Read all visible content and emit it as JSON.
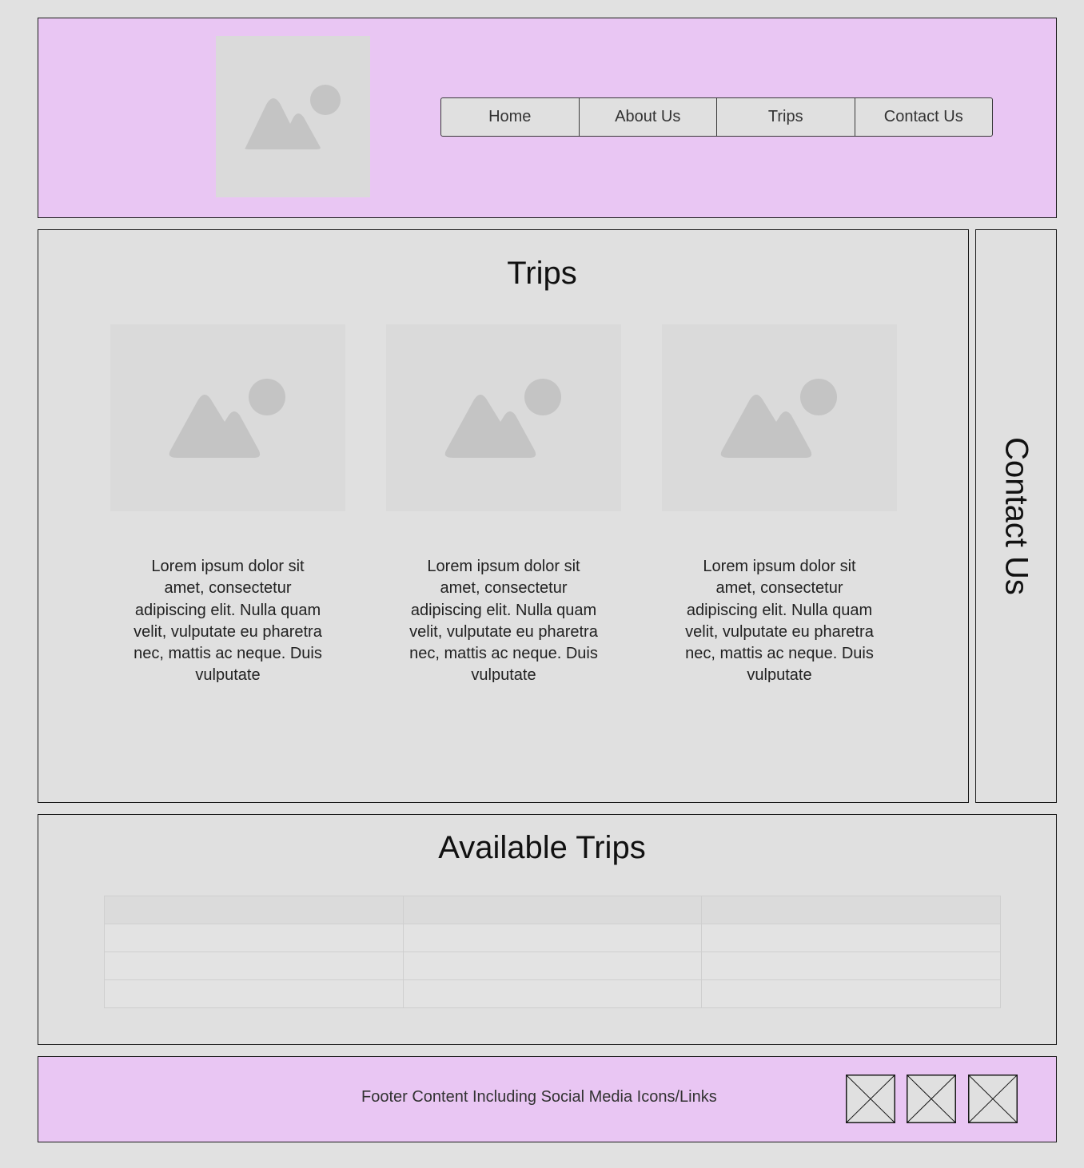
{
  "header": {
    "logo": {
      "icon": "image-placeholder-icon"
    },
    "nav": [
      {
        "label": "Home"
      },
      {
        "label": "About Us"
      },
      {
        "label": "Trips"
      },
      {
        "label": "Contact Us"
      }
    ]
  },
  "main": {
    "title": "Trips",
    "cards": [
      {
        "image_icon": "image-placeholder-icon",
        "text": "Lorem ipsum dolor sit amet, consectetur adipiscing elit. Nulla quam velit, vulputate eu pharetra nec, mattis ac neque. Duis vulputate"
      },
      {
        "image_icon": "image-placeholder-icon",
        "text": "Lorem ipsum dolor sit amet, consectetur adipiscing elit. Nulla quam velit, vulputate eu pharetra nec, mattis ac neque. Duis vulputate"
      },
      {
        "image_icon": "image-placeholder-icon",
        "text": "Lorem ipsum dolor sit amet, consectetur adipiscing elit. Nulla quam velit, vulputate eu pharetra nec, mattis ac neque. Duis vulputate"
      }
    ]
  },
  "sidebar": {
    "label": "Contact Us"
  },
  "available_trips": {
    "title": "Available Trips",
    "columns": [
      "",
      "",
      ""
    ],
    "rows": [
      [
        "",
        "",
        ""
      ],
      [
        "",
        "",
        ""
      ],
      [
        "",
        "",
        ""
      ]
    ]
  },
  "footer": {
    "text": "Footer Content Including Social Media Icons/Links",
    "social_icons": [
      "social-media-placeholder-icon",
      "social-media-placeholder-icon",
      "social-media-placeholder-icon"
    ]
  },
  "colors": {
    "page_background": "#e1e1e1",
    "header_footer_background": "#e9c6f3",
    "placeholder_background": "#dadada",
    "placeholder_glyph": "#c4c4c4",
    "border": "#1a1a1a"
  }
}
